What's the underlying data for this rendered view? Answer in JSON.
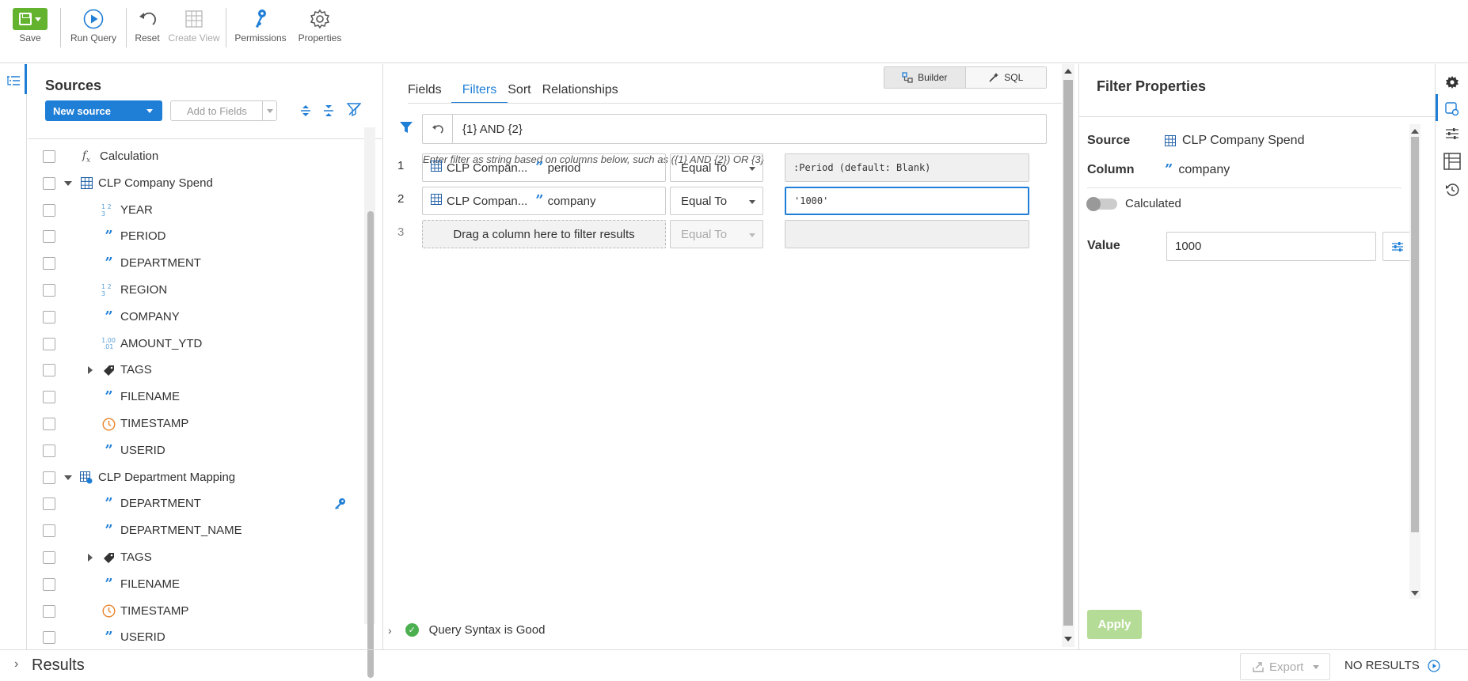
{
  "toolbar": {
    "save": "Save",
    "run_query": "Run Query",
    "reset": "Reset",
    "create_view": "Create View",
    "permissions": "Permissions",
    "properties": "Properties"
  },
  "sources": {
    "title": "Sources",
    "new_source": "New source",
    "add_to_fields": "Add to Fields",
    "tree": [
      {
        "label": "Calculation",
        "icon": "function-icon",
        "level": 0
      },
      {
        "label": "CLP Company Spend",
        "icon": "table-icon",
        "level": 0,
        "expanded": true
      },
      {
        "label": "YEAR",
        "icon": "numeric-icon",
        "level": 1
      },
      {
        "label": "PERIOD",
        "icon": "text-field-icon",
        "level": 1
      },
      {
        "label": "DEPARTMENT",
        "icon": "text-field-icon",
        "level": 1
      },
      {
        "label": "REGION",
        "icon": "numeric-icon",
        "level": 1
      },
      {
        "label": "COMPANY",
        "icon": "text-field-icon",
        "level": 1
      },
      {
        "label": "AMOUNT_YTD",
        "icon": "decimal-icon",
        "level": 1
      },
      {
        "label": "TAGS",
        "icon": "tag-icon",
        "level": 1,
        "collapsed": true
      },
      {
        "label": "FILENAME",
        "icon": "text-field-icon",
        "level": 1
      },
      {
        "label": "TIMESTAMP",
        "icon": "clock-icon",
        "level": 1
      },
      {
        "label": "USERID",
        "icon": "text-field-icon",
        "level": 1
      },
      {
        "label": "CLP Department Mapping",
        "icon": "linked-table-icon",
        "level": 0,
        "expanded": true
      },
      {
        "label": "DEPARTMENT",
        "icon": "text-field-icon",
        "level": 1,
        "key": true
      },
      {
        "label": "DEPARTMENT_NAME",
        "icon": "text-field-icon",
        "level": 1
      },
      {
        "label": "TAGS",
        "icon": "tag-icon",
        "level": 1,
        "collapsed": true
      },
      {
        "label": "FILENAME",
        "icon": "text-field-icon",
        "level": 1
      },
      {
        "label": "TIMESTAMP",
        "icon": "clock-icon",
        "level": 1
      },
      {
        "label": "USERID",
        "icon": "text-field-icon",
        "level": 1
      }
    ]
  },
  "center": {
    "tabs": [
      "Fields",
      "Filters",
      "Sort",
      "Relationships"
    ],
    "active_tab": "Filters",
    "mode": {
      "builder": "Builder",
      "sql": "SQL"
    },
    "expression": "{1} AND {2}",
    "hint": "Enter filter as string based on columns below, such as ({1} AND {2}) OR {3}",
    "filters": [
      {
        "num": "1",
        "source": "CLP Compan...",
        "column": "period",
        "operator": "Equal To",
        "value": ":Period (default: Blank)"
      },
      {
        "num": "2",
        "source": "CLP Compan...",
        "column": "company",
        "operator": "Equal To",
        "value": "'1000'"
      }
    ],
    "drop_row": {
      "num": "3",
      "placeholder": "Drag a column here to filter results",
      "operator": "Equal To"
    },
    "status": "Query Syntax is Good"
  },
  "props": {
    "title": "Filter Properties",
    "source_label": "Source",
    "source_value": "CLP Company Spend",
    "column_label": "Column",
    "column_value": "company",
    "calculated_label": "Calculated",
    "value_label": "Value",
    "value": "1000",
    "apply": "Apply"
  },
  "bottom": {
    "results": "Results",
    "export": "Export",
    "no_results": "NO RESULTS"
  },
  "colors": {
    "accent": "#1f7ed6",
    "save_green": "#63b32f",
    "ok_green": "#4caf50",
    "apply_disabled": "#b5dc96"
  }
}
